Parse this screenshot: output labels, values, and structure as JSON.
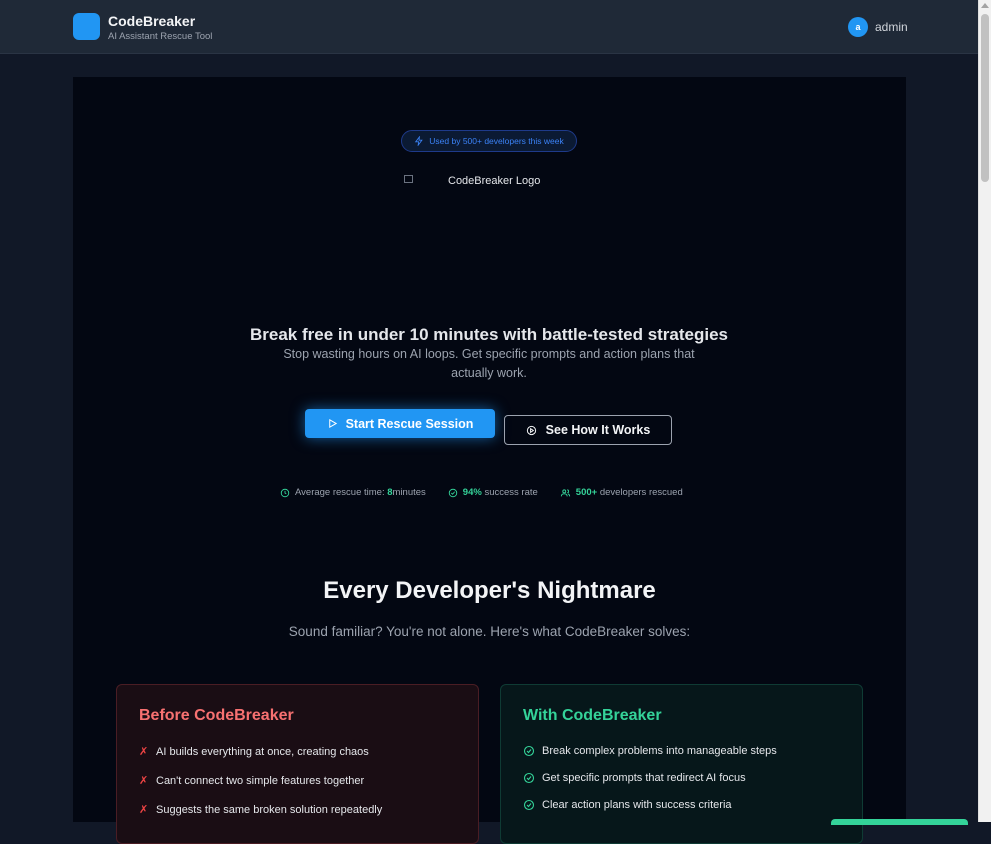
{
  "header": {
    "app_name": "CodeBreaker",
    "tagline": "AI Assistant Rescue Tool",
    "user_initial": "a",
    "username": "admin"
  },
  "hero": {
    "badge": "Used by 500+ developers this week",
    "logo_alt": "CodeBreaker Logo",
    "heading": "Break free in under 10 minutes with battle-tested strategies",
    "subheading": "Stop wasting hours on AI loops. Get specific prompts and action plans that actually work.",
    "primary_button": "Start Rescue Session",
    "secondary_button": "See How It Works"
  },
  "stats": {
    "rescue_prefix": "Average rescue time: ",
    "rescue_value": "8",
    "rescue_suffix": "minutes",
    "success_value": "94%",
    "success_suffix": " success rate",
    "devs_value": "500+",
    "devs_suffix": " developers rescued"
  },
  "nightmare": {
    "title": "Every Developer's Nightmare",
    "subtitle": "Sound familiar? You're not alone. Here's what CodeBreaker solves:",
    "before": {
      "title": "Before CodeBreaker",
      "items": [
        "AI builds everything at once, creating chaos",
        "Can't connect two simple features together",
        "Suggests the same broken solution repeatedly"
      ]
    },
    "after": {
      "title": "With CodeBreaker",
      "items": [
        "Break complex problems into manageable steps",
        "Get specific prompts that redirect AI focus",
        "Clear action plans with success criteria"
      ]
    }
  },
  "colors": {
    "accent_blue": "#2196f3",
    "success_green": "#34d399",
    "danger_red": "#f87171"
  },
  "icons": {
    "badge": "sparkle-icon",
    "primary_button": "play-icon",
    "secondary_button": "play-circle-icon",
    "stat_rescue": "clock-icon",
    "stat_success": "check-circle-icon",
    "stat_devs": "users-icon",
    "before_item": "x-mark-icon",
    "after_item": "check-circle-icon"
  }
}
